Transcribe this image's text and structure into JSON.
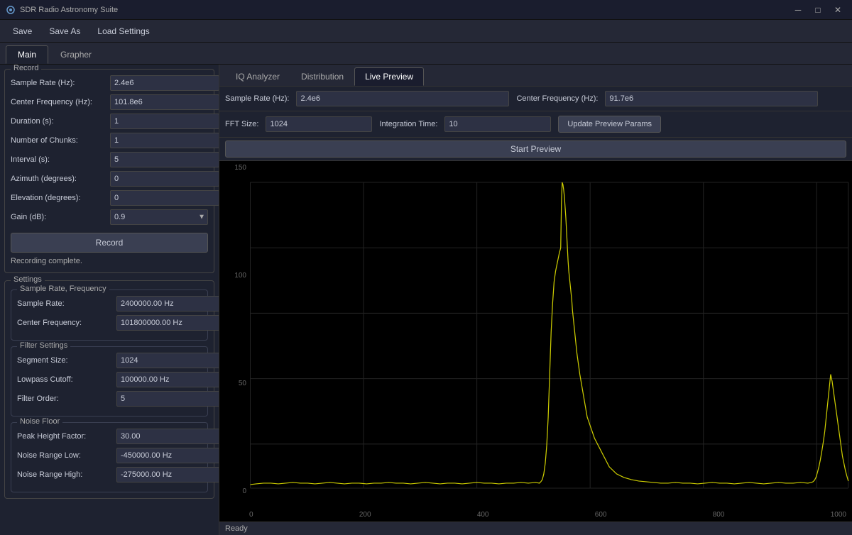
{
  "app": {
    "title": "SDR Radio Astronomy Suite"
  },
  "titlebar": {
    "minimize": "─",
    "maximize": "□",
    "close": "✕"
  },
  "menubar": {
    "save": "Save",
    "save_as": "Save As",
    "load_settings": "Load Settings"
  },
  "main_tabs": [
    {
      "id": "main",
      "label": "Main",
      "active": true
    },
    {
      "id": "grapher",
      "label": "Grapher",
      "active": false
    }
  ],
  "record_group": {
    "title": "Record",
    "fields": [
      {
        "label": "Sample Rate (Hz):",
        "value": "2.4e6",
        "name": "sample-rate"
      },
      {
        "label": "Center Frequency (Hz):",
        "value": "101.8e6",
        "name": "center-freq"
      },
      {
        "label": "Duration (s):",
        "value": "1",
        "name": "duration"
      },
      {
        "label": "Number of Chunks:",
        "value": "1",
        "name": "num-chunks"
      },
      {
        "label": "Interval (s):",
        "value": "5",
        "name": "interval"
      },
      {
        "label": "Azimuth (degrees):",
        "value": "0",
        "name": "azimuth"
      },
      {
        "label": "Elevation (degrees):",
        "value": "0",
        "name": "elevation"
      },
      {
        "label": "Gain (dB):",
        "value": "0.9",
        "name": "gain",
        "dropdown": true
      }
    ],
    "record_btn": "Record",
    "status": "Recording complete."
  },
  "settings_group": {
    "title": "Settings",
    "sample_freq_group": {
      "title": "Sample Rate, Frequency",
      "fields": [
        {
          "label": "Sample Rate:",
          "value": "2400000.00 Hz",
          "name": "settings-sample-rate"
        },
        {
          "label": "Center Frequency:",
          "value": "101800000.00 Hz",
          "name": "settings-center-freq"
        }
      ]
    },
    "filter_group": {
      "title": "Filter Settings",
      "fields": [
        {
          "label": "Segment Size:",
          "value": "1024",
          "name": "segment-size"
        },
        {
          "label": "Lowpass Cutoff:",
          "value": "100000.00 Hz",
          "name": "lowpass-cutoff"
        },
        {
          "label": "Filter Order:",
          "value": "5",
          "name": "filter-order"
        }
      ]
    },
    "noise_group": {
      "title": "Noise Floor",
      "fields": [
        {
          "label": "Peak Height Factor:",
          "value": "30.00",
          "name": "peak-height"
        },
        {
          "label": "Noise Range Low:",
          "value": "-450000.00 Hz",
          "name": "noise-low"
        },
        {
          "label": "Noise Range High:",
          "value": "-275000.00 Hz",
          "name": "noise-high"
        }
      ]
    }
  },
  "inner_tabs": [
    {
      "id": "iq",
      "label": "IQ Analyzer",
      "active": false
    },
    {
      "id": "distribution",
      "label": "Distribution",
      "active": false
    },
    {
      "id": "live_preview",
      "label": "Live Preview",
      "active": true
    }
  ],
  "preview_params": {
    "sample_rate_label": "Sample Rate (Hz):",
    "sample_rate_value": "2.4e6",
    "center_freq_label": "Center Frequency (Hz):",
    "center_freq_value": "91.7e6",
    "fft_size_label": "FFT Size:",
    "fft_size_value": "1024",
    "integration_label": "Integration Time:",
    "integration_value": "10",
    "update_btn": "Update Preview Params",
    "start_btn": "Start Preview"
  },
  "chart": {
    "y_labels": [
      "150",
      "100",
      "50",
      "0"
    ],
    "x_labels": [
      "0",
      "200",
      "400",
      "600",
      "800",
      "1000"
    ],
    "y_max": 160,
    "y_min": -10,
    "x_max": 1100
  },
  "statusbar": {
    "text": "Ready"
  }
}
